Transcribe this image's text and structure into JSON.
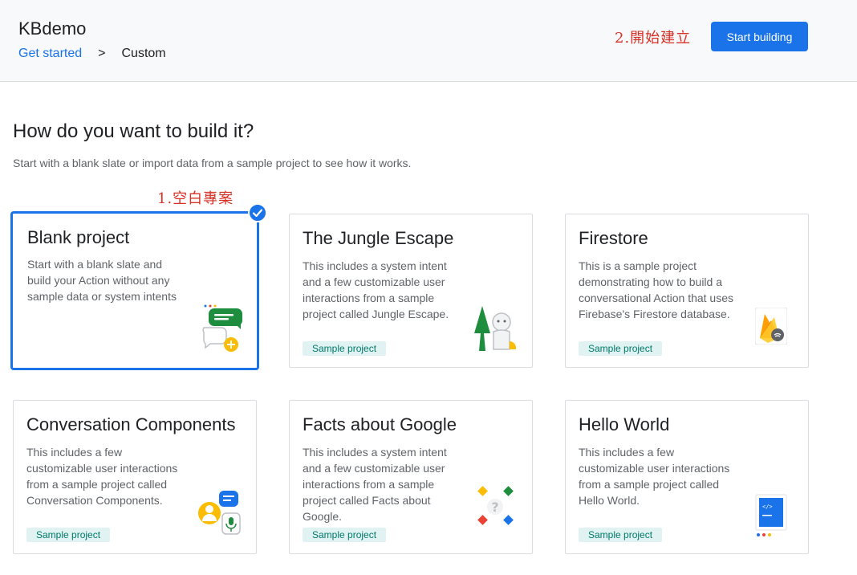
{
  "header": {
    "app_title": "KBdemo",
    "breadcrumb": {
      "link": "Get started",
      "separator": ">",
      "current": "Custom"
    },
    "annotation_2": "2.開始建立",
    "start_button": "Start building"
  },
  "main": {
    "heading": "How do you want to build it?",
    "subheading": "Start with a blank slate or import data from a sample project to see how it works.",
    "annotation_1": "1.空白專案"
  },
  "cards": [
    {
      "title": "Blank project",
      "desc": "Start with a blank slate and build your Action without any sample data or system intents",
      "badge": "",
      "icon": "chat-bubbles-icon",
      "selected": true
    },
    {
      "title": "The Jungle Escape",
      "desc": "This includes a system intent and a few customizable user interactions from a sample project called Jungle Escape.",
      "badge": "Sample project",
      "icon": "jungle-monkey-icon"
    },
    {
      "title": "Firestore",
      "desc": "This is a sample project demonstrating how to build a conversational Action that uses Firebase's Firestore database.",
      "badge": "Sample project",
      "icon": "firebase-icon"
    },
    {
      "title": "Conversation Components",
      "desc": "This includes a few customizable user interactions from a sample project called Conversation Components.",
      "badge": "Sample project",
      "icon": "conversation-icon"
    },
    {
      "title": "Facts about Google",
      "desc": "This includes a system intent and a few customizable user interactions from a sample project called Facts about Google.",
      "badge": "Sample project",
      "icon": "google-facts-icon"
    },
    {
      "title": "Hello World",
      "desc": "This includes a few customizable user interactions from a sample project called Hello World.",
      "badge": "Sample project",
      "icon": "code-doc-icon"
    }
  ],
  "colors": {
    "accent": "#1a73e8",
    "annotation": "#d93025",
    "badge_bg": "#e0f2f1",
    "badge_text": "#00796b"
  }
}
